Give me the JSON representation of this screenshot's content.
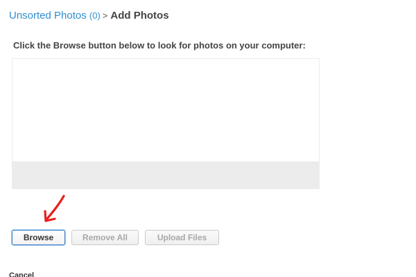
{
  "breadcrumb": {
    "parent_label": "Unsorted Photos",
    "parent_count": "(0)",
    "separator": ">",
    "current": "Add Photos"
  },
  "instructions": "Click the Browse button below to look for photos on your computer:",
  "buttons": {
    "browse": "Browse",
    "remove_all": "Remove All",
    "upload_files": "Upload Files"
  },
  "cancel_label": "Cancel",
  "colors": {
    "link": "#2f8fd0",
    "arrow": "#e8201e",
    "focus_border": "#3b7fc4"
  }
}
